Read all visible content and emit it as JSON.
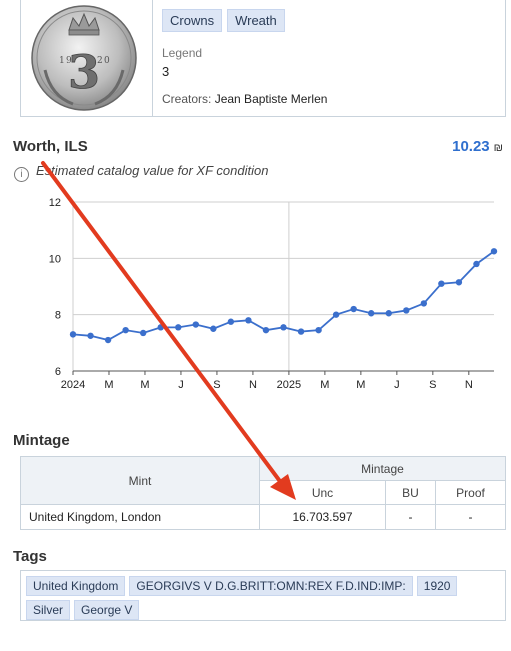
{
  "coin": {
    "categories": [
      "Crowns",
      "Wreath"
    ],
    "legend_label": "Legend",
    "legend_value": "3",
    "creators_label": "Creators:",
    "creators_value": "Jean Baptiste Merlen"
  },
  "worth": {
    "title": "Worth, ILS",
    "value": "10.23",
    "currency_symbol": "₪",
    "info_text": "Estimated catalog value for XF condition"
  },
  "chart_data": {
    "type": "line",
    "x": [
      "2024-01",
      "2024-02",
      "2024-03",
      "2024-04",
      "2024-05",
      "2024-06",
      "2024-07",
      "2024-08",
      "2024-09",
      "2024-10",
      "2024-11",
      "2024-12",
      "2025-01",
      "2025-02",
      "2025-03",
      "2025-04",
      "2025-05",
      "2025-06",
      "2025-07",
      "2025-08",
      "2025-09",
      "2025-10",
      "2025-11",
      "2025-12"
    ],
    "y_points": [
      7.3,
      7.25,
      7.1,
      7.45,
      7.35,
      7.55,
      7.55,
      7.65,
      7.5,
      7.75,
      7.8,
      7.45,
      7.55,
      7.4,
      7.45,
      8.0,
      8.2,
      8.05,
      8.05,
      8.15,
      8.4,
      9.1,
      9.15,
      9.8,
      10.25
    ],
    "x_tick_labels": [
      "2024",
      "M",
      "M",
      "J",
      "S",
      "N",
      "2025",
      "M",
      "M",
      "J",
      "S",
      "N"
    ],
    "y_ticks": [
      6,
      8,
      10,
      12
    ],
    "ylim": [
      6,
      12
    ],
    "grid": true,
    "color": "#3b6fcc"
  },
  "mintage": {
    "title": "Mintage",
    "headers": {
      "mint": "Mint",
      "mintage": "Mintage",
      "unc": "Unc",
      "bu": "BU",
      "proof": "Proof"
    },
    "rows": [
      {
        "mint": "United Kingdom, London",
        "unc": "16.703.597",
        "bu": "-",
        "proof": "-"
      }
    ]
  },
  "tags": {
    "title": "Tags",
    "items": [
      "United Kingdom",
      "GEORGIVS V D.G.BRITT:OMN:REX F.D.IND:IMP:",
      "1920",
      "Silver",
      "George V"
    ]
  },
  "colors": {
    "accent": "#2f6fce",
    "arrow": "#e23b1f",
    "chip_bg": "#dde6f5"
  }
}
